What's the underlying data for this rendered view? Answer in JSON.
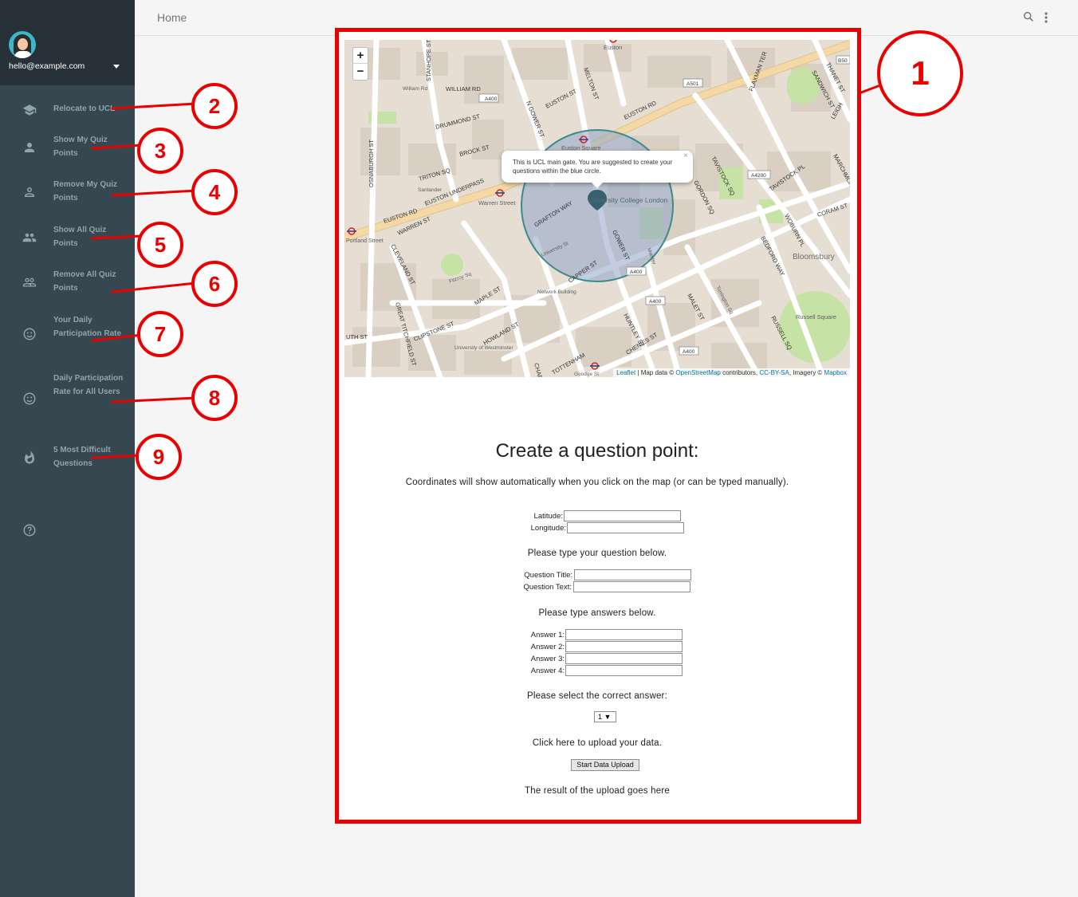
{
  "app": {
    "page_title": "Home"
  },
  "sidebar": {
    "email": "hello@example.com",
    "items": [
      {
        "label": "Relocate to UCL",
        "icon": "school-icon"
      },
      {
        "label": "Show My Quiz Points",
        "icon": "person-icon"
      },
      {
        "label": "Remove My Quiz Points",
        "icon": "person-outline-icon"
      },
      {
        "label": "Show All Quiz Points",
        "icon": "people-icon"
      },
      {
        "label": "Remove All Quiz Points",
        "icon": "people-outline-icon"
      },
      {
        "label": "Your Daily Participation Rate",
        "icon": "smiley-icon"
      },
      {
        "label": "Daily Participation Rate for All Users",
        "icon": "smiley-outline-icon"
      },
      {
        "label": "5 Most Difficult Questions",
        "icon": "fire-icon"
      }
    ],
    "help_icon": "help-icon"
  },
  "map": {
    "zoom_in": "+",
    "zoom_out": "−",
    "popup": "This is UCL main gate. You are suggested to create your questions within the blue circle.",
    "popup_close": "×",
    "attribution": {
      "leaflet": "Leaflet",
      "sep1": " | Map data © ",
      "osm": "OpenStreetMap",
      "sep2": " contributors, ",
      "license": "CC-BY-SA",
      "sep3": ", Imagery © ",
      "provider": "Mapbox"
    },
    "labels": {
      "euston": "Euston",
      "euston_square": "Euston Square",
      "warren_street": "Warren Street",
      "ucl": "University College London",
      "bloomsbury": "Bloomsbury",
      "russell_square": "Russell Square",
      "network_building": "Network Building",
      "univ_westminster": "University of Westminster",
      "portland": "Portland Street",
      "santander": "Santander",
      "goodge": "Goodge St",
      "william_rd": "William Rd",
      "euston_underpass": "EUSTON UNDERPASS",
      "euston_rd_w": "EUSTON RD",
      "euston_rd_e": "EUSTON RD",
      "grafton_way": "GRAFTON WAY",
      "gower_st": "GOWER ST",
      "gordon_sq": "GORDON SQ",
      "tavistock_sq": "TAVISTOCK SQ",
      "tavistock_pl": "TAVISTOCK PL",
      "woburn_pl": "WOBURN PL",
      "bedford_way": "BEDFORD WAY",
      "russell_sq": "RUSSELL SQ",
      "malet_st": "MALET ST",
      "huntley_st": "HUNTLEY ST",
      "chenies_st": "CHENIES ST",
      "howland_st": "HOWLAND ST",
      "maple_st": "MAPLE ST",
      "cleveland_st": "CLEVELAND ST",
      "clipstone_st": "CLIPSTONE ST",
      "great_titchfield_st": "GREAT TITCHFIELD ST",
      "warren_st": "WARREN ST",
      "drummond_st": "DRUMMOND ST",
      "brock_st": "BROCK ST",
      "triton_sq": "TRITON SQ",
      "melton_st": "MELTON ST",
      "n_gower_st": "N GOWER ST",
      "euston_st": "EUSTON ST",
      "stanhope_st": "STANHOPE ST",
      "osnaburgh_st": "OSNABURGH ST",
      "william_rd_st": "WILLIAM RD",
      "coram_st": "CORAM ST",
      "flaxman_ter": "FLAXMAN TER",
      "sandwich_st": "SANDWICH ST",
      "thanet_st": "THANET ST",
      "marchmont_st": "MARCHMONT ST",
      "leigh": "LEIGH",
      "a400_1": "A400",
      "a400_2": "A400",
      "a400_3": "A400",
      "a400_4": "A400",
      "a501": "A501",
      "a4200": "A4200",
      "b50": "B50",
      "fitzroy_sq": "Fitzroy Sq",
      "torrington_sq": "Torrington Sq",
      "university_st": "University St",
      "capper_st": "CAPPER ST",
      "tottenham": "TOTTENHAM",
      "charl": "CHARL",
      "uth_st": "UTH ST",
      "mandeville": "Mandev"
    }
  },
  "form": {
    "heading": "Create a question point:",
    "coords_hint": "Coordinates will show automatically when you click on the map (or can be typed manually).",
    "latitude_label": "Latitude:",
    "longitude_label": "Longitude:",
    "latitude_value": "",
    "longitude_value": "",
    "question_prompt": "Please type your question below.",
    "question_title_label": "Question Title:",
    "question_text_label": "Question Text:",
    "answers_prompt": "Please type answers below.",
    "answer1_label": "Answer 1:",
    "answer2_label": "Answer 2:",
    "answer3_label": "Answer 3:",
    "answer4_label": "Answer 4:",
    "correct_prompt": "Please select the correct answer:",
    "correct_selected": "1 ▼",
    "upload_prompt": "Click here to upload your data.",
    "upload_button": "Start Data Upload",
    "upload_result": "The result of the upload goes here"
  },
  "annotations": {
    "badges": [
      "1",
      "2",
      "3",
      "4",
      "5",
      "6",
      "7",
      "8",
      "9"
    ],
    "color": "#ea0000"
  }
}
